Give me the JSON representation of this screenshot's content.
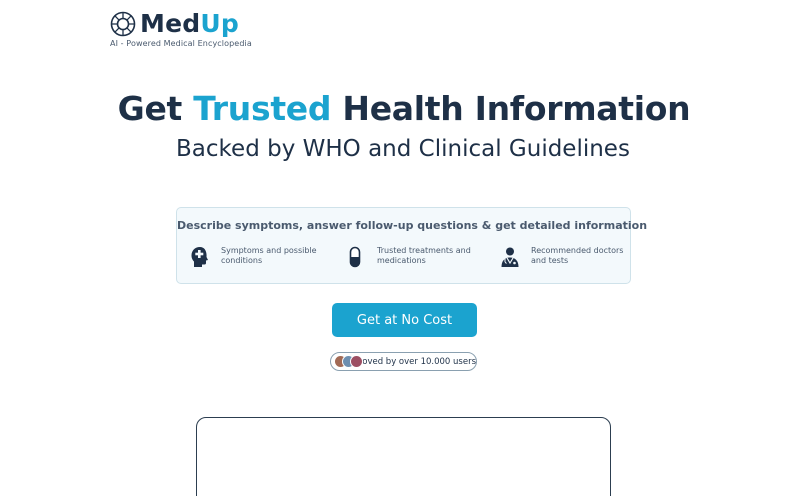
{
  "brand": {
    "name_part1": "Med",
    "name_part2": "Up",
    "tagline": "AI - Powered Medical Encyclopedia",
    "logo_icon": "sun-ring-logo-icon",
    "colors": {
      "primary": "#1e3047",
      "accent": "#1ba3cf"
    }
  },
  "hero": {
    "title_part1": "Get ",
    "title_accent": "Trusted",
    "title_part2": " Health Information",
    "subtitle": "Backed by WHO and Clinical Guidelines"
  },
  "features_card": {
    "heading": "Describe symptoms, answer follow-up questions & get detailed information",
    "items": [
      {
        "icon": "head-plus-icon",
        "label": "Symptoms and possible conditions"
      },
      {
        "icon": "pill-capsule-icon",
        "label": "Trusted treatments and medications"
      },
      {
        "icon": "doctor-icon",
        "label": "Recommended doctors and tests"
      }
    ]
  },
  "cta": {
    "label": "Get at No Cost"
  },
  "social_proof": {
    "text": "Loved by over 10.000 users"
  }
}
